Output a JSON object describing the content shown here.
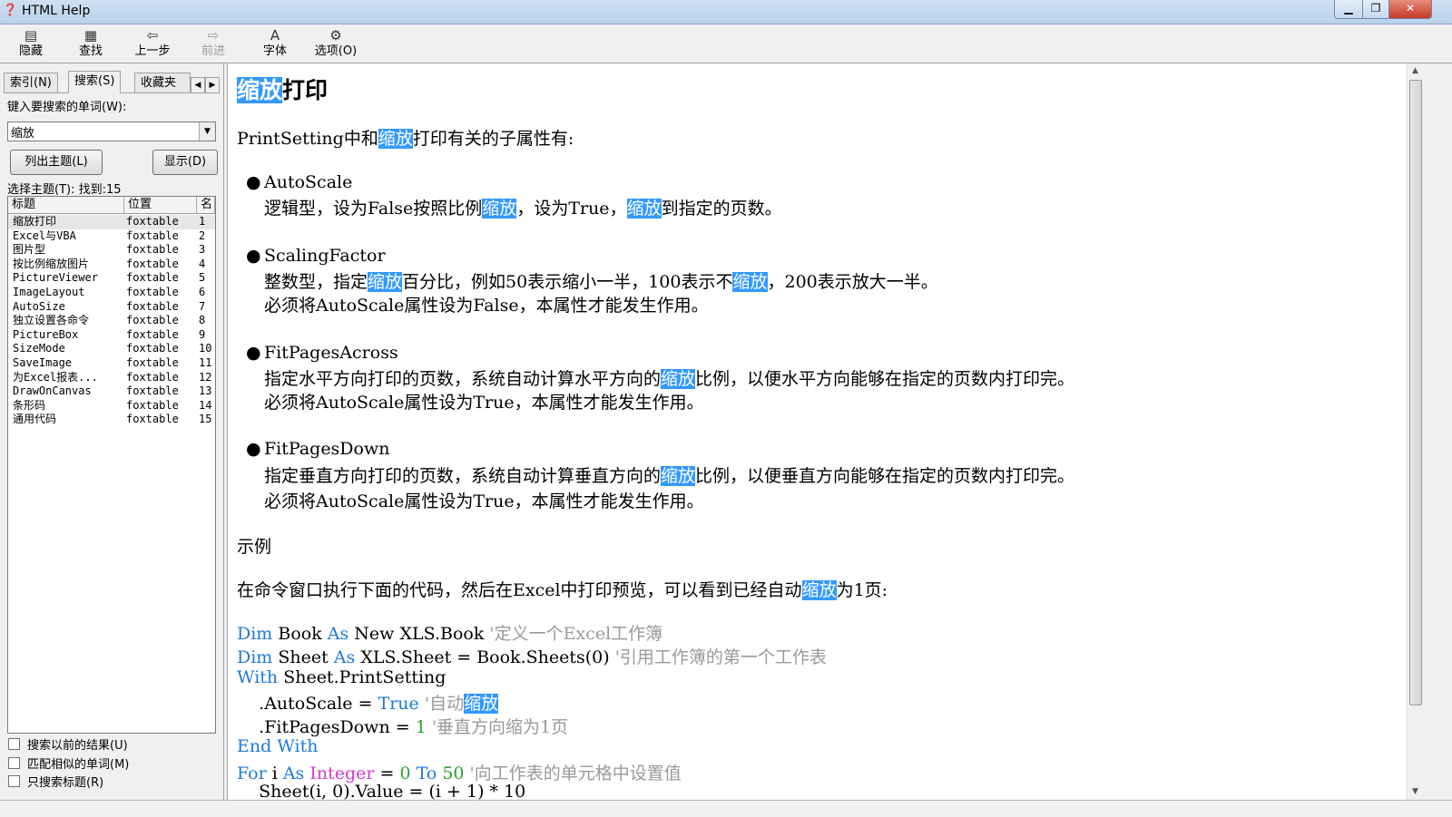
{
  "window": {
    "title": "HTML Help"
  },
  "toolbar": [
    {
      "label": "隐藏",
      "icon": "hide-icon",
      "enabled": true
    },
    {
      "label": "查找",
      "icon": "find-icon",
      "enabled": true
    },
    {
      "label": "上一步",
      "icon": "back-arrow-icon",
      "enabled": true
    },
    {
      "label": "前进",
      "icon": "forward-arrow-icon",
      "enabled": false
    },
    {
      "label": "字体",
      "icon": "font-icon",
      "enabled": true
    },
    {
      "label": "选项(O)",
      "icon": "options-icon",
      "enabled": true
    }
  ],
  "left": {
    "tabs": [
      "索引(N)",
      "搜索(S)",
      "收藏夹"
    ],
    "active_tab": "搜索(S)",
    "search_prompt": "键入要搜索的单词(W):",
    "search_value": "缩放",
    "list_topics_button": "列出主题(L)",
    "display_button": "显示(D)",
    "result_label": "选择主题(T): 找到:15",
    "columns": [
      "标题",
      "位置",
      "名"
    ],
    "rows": [
      {
        "title": "缩放打印",
        "location": "foxtable",
        "rank": "1"
      },
      {
        "title": "Excel与VBA",
        "location": "foxtable",
        "rank": "2"
      },
      {
        "title": "图片型",
        "location": "foxtable",
        "rank": "3"
      },
      {
        "title": "按比例缩放图片",
        "location": "foxtable",
        "rank": "4"
      },
      {
        "title": "PictureViewer",
        "location": "foxtable",
        "rank": "5"
      },
      {
        "title": "ImageLayout",
        "location": "foxtable",
        "rank": "6"
      },
      {
        "title": "AutoSize",
        "location": "foxtable",
        "rank": "7"
      },
      {
        "title": "独立设置各命令",
        "location": "foxtable",
        "rank": "8"
      },
      {
        "title": "PictureBox",
        "location": "foxtable",
        "rank": "9"
      },
      {
        "title": "SizeMode",
        "location": "foxtable",
        "rank": "10"
      },
      {
        "title": "SaveImage",
        "location": "foxtable",
        "rank": "11"
      },
      {
        "title": "为Excel报表...",
        "location": "foxtable",
        "rank": "12"
      },
      {
        "title": "DrawOnCanvas",
        "location": "foxtable",
        "rank": "13"
      },
      {
        "title": "条形码",
        "location": "foxtable",
        "rank": "14"
      },
      {
        "title": "通用代码",
        "location": "foxtable",
        "rank": "15"
      }
    ],
    "checkboxes": [
      "搜索以前的结果(U)",
      "匹配相似的单词(M)",
      "只搜索标题(R)"
    ]
  },
  "content": {
    "heading_hl": "缩放",
    "heading_rest": "打印",
    "intro": [
      "PrintSetting中和",
      "缩放",
      "打印有关的子属性有:"
    ],
    "props": [
      {
        "name": "AutoScale",
        "line1": [
          "逻辑型，设为False按照比例",
          "缩放",
          "，设为True，",
          "缩放",
          "到指定的页数。"
        ],
        "line2": ""
      },
      {
        "name": "ScalingFactor",
        "line1": [
          "整数型，指定",
          "缩放",
          "百分比，例如50表示缩小一半，100表示不",
          "缩放",
          "，200表示放大一半。"
        ],
        "line2": "必须将AutoScale属性设为False，本属性才能发生作用。"
      },
      {
        "name": "FitPagesAcross",
        "line1": [
          "指定水平方向打印的页数，系统自动计算水平方向的",
          "缩放",
          "比例，以便水平方向能够在指定的页数内打印完。"
        ],
        "line2": "必须将AutoScale属性设为True，本属性才能发生作用。"
      },
      {
        "name": "FitPagesDown",
        "line1": [
          "指定垂直方向打印的页数，系统自动计算垂直方向的",
          "缩放",
          "比例，以便垂直方向能够在指定的页数内打印完。"
        ],
        "line2": "必须将AutoScale属性设为True，本属性才能发生作用。"
      }
    ],
    "example_heading": "示例",
    "example_desc": [
      "在命令窗口执行下面的代码，然后在Excel中打印预览，可以看到已经自动",
      "缩放",
      "为1页:"
    ],
    "code": {
      "l1": [
        "Dim",
        " Book ",
        "As",
        " New XLS.Book ",
        "'定义一个Excel工作簿"
      ],
      "l2": [
        "Dim",
        " Sheet ",
        "As",
        " XLS.Sheet = Book.Sheets(0) ",
        "'引用工作簿的第一个工作表"
      ],
      "l3": [
        "With",
        " Sheet.PrintSetting"
      ],
      "l4": [
        "    .AutoScale = ",
        "True",
        " ",
        "'自动",
        "缩放"
      ],
      "l5": [
        "    .FitPagesDown = ",
        "1",
        " ",
        "'垂直方向缩为1页"
      ],
      "l6": [
        "End With"
      ],
      "l7": [
        "For",
        " i ",
        "As",
        " ",
        "Integer",
        " = ",
        "0",
        " ",
        "To",
        " ",
        "50",
        " ",
        "'向工作表的单元格中设置值"
      ],
      "l8": [
        "    Sheet(i, 0).Value = (i + 1) * 10"
      ]
    }
  }
}
